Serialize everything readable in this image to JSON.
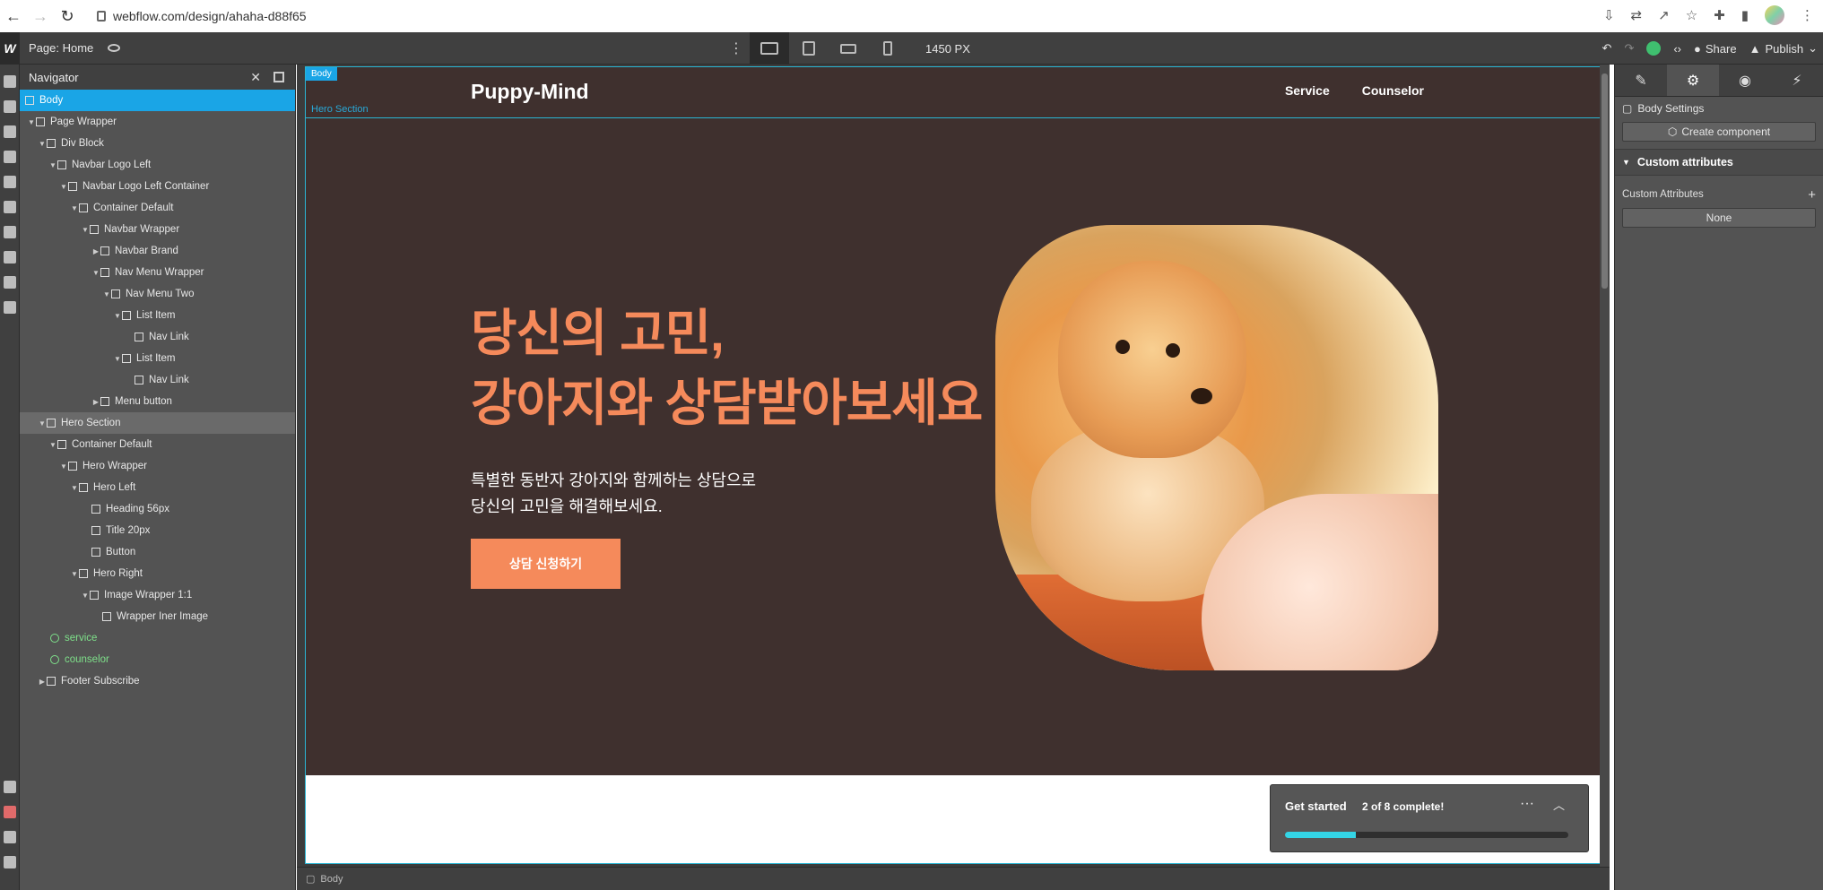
{
  "browser": {
    "url": "webflow.com/design/ahaha-d88f65"
  },
  "topbar": {
    "page_label": "Page: Home",
    "width_label": "1450 PX",
    "share": "Share",
    "publish": "Publish"
  },
  "navigator": {
    "title": "Navigator",
    "items": [
      {
        "label": "Body"
      },
      {
        "label": "Page Wrapper"
      },
      {
        "label": "Div Block"
      },
      {
        "label": "Navbar Logo Left"
      },
      {
        "label": "Navbar Logo Left Container"
      },
      {
        "label": "Container Default"
      },
      {
        "label": "Navbar Wrapper"
      },
      {
        "label": "Navbar Brand"
      },
      {
        "label": "Nav Menu Wrapper"
      },
      {
        "label": "Nav Menu Two"
      },
      {
        "label": "List Item"
      },
      {
        "label": "Nav Link"
      },
      {
        "label": "List Item"
      },
      {
        "label": "Nav Link"
      },
      {
        "label": "Menu button"
      },
      {
        "label": "Hero Section"
      },
      {
        "label": "Container Default"
      },
      {
        "label": "Hero Wrapper"
      },
      {
        "label": "Hero Left"
      },
      {
        "label": "Heading 56px"
      },
      {
        "label": "Title 20px"
      },
      {
        "label": "Button"
      },
      {
        "label": "Hero Right"
      },
      {
        "label": "Image Wrapper 1:1"
      },
      {
        "label": "Wrapper Iner Image"
      },
      {
        "label": "service"
      },
      {
        "label": "counselor"
      },
      {
        "label": "Footer Subscribe"
      }
    ]
  },
  "canvas": {
    "body_tag": "Body",
    "hero_tag": "Hero Section",
    "brand": "Puppy-Mind",
    "nav_links": [
      "Service",
      "Counselor"
    ],
    "hero_heading_line1": "당신의 고민,",
    "hero_heading_line2": "강아지와 상담받아보세요",
    "hero_sub_line1": "특별한 동반자 강아지와 함께하는 상담으로",
    "hero_sub_line2": "당신의 고민을 해결해보세요.",
    "hero_button": "상담 신청하기",
    "footer_crumb": "Body"
  },
  "get_started": {
    "title": "Get started",
    "count": "2 of 8 complete!",
    "progress_fraction": 0.25
  },
  "right_panel": {
    "body_settings": "Body Settings",
    "create_component": "Create component",
    "section_title": "Custom attributes",
    "attr_label": "Custom Attributes",
    "attr_value": "None"
  },
  "colors": {
    "accent_orange": "#f58a5b",
    "hero_bg": "#3f302e",
    "selection_blue": "#1aa5e6",
    "progress_cyan": "#34d5e6"
  }
}
